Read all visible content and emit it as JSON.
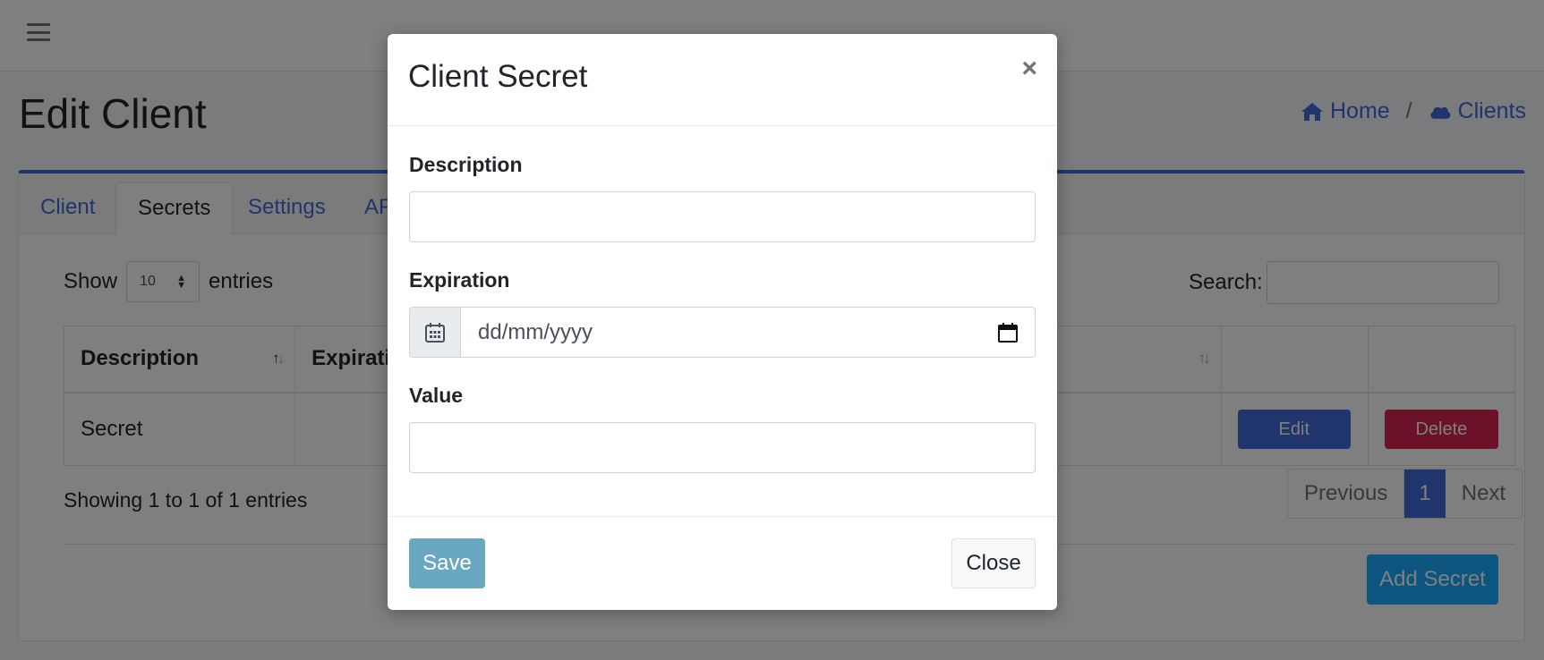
{
  "navbar": {
    "menu_icon": "hamburger-icon"
  },
  "page": {
    "title": "Edit Client",
    "breadcrumb": [
      {
        "label": "Home",
        "icon": "home-icon"
      },
      {
        "label": "Clients",
        "icon": "cloud-icon"
      }
    ],
    "breadcrumb_separator": "/"
  },
  "tabs": [
    {
      "label": "Client",
      "active": false
    },
    {
      "label": "Secrets",
      "active": true
    },
    {
      "label": "Settings",
      "active": false
    },
    {
      "label": "AP",
      "active": false
    }
  ],
  "table_controls": {
    "show_label": "Show",
    "entries_value": "10",
    "entries_label": "entries",
    "search_label": "Search:"
  },
  "table": {
    "headers": [
      "Description",
      "Expiration",
      ""
    ],
    "rows": [
      {
        "description": "Secret",
        "expiration": "",
        "value": "",
        "edit_label": "Edit",
        "delete_label": "Delete"
      }
    ]
  },
  "footer": {
    "showing": "Showing 1 to 1 of 1 entries",
    "pagination": {
      "previous": "Previous",
      "current": "1",
      "next": "Next"
    },
    "add_button": "Add Secret"
  },
  "modal": {
    "title": "Client Secret",
    "close_symbol": "×",
    "fields": {
      "description_label": "Description",
      "description_value": "",
      "expiration_label": "Expiration",
      "expiration_placeholder": "dd/mm/yyyy",
      "value_label": "Value",
      "value_value": ""
    },
    "save_label": "Save",
    "close_label": "Close"
  },
  "colors": {
    "primary": "#3f6ad8",
    "danger": "#d92550",
    "info": "#16aaff",
    "save": "#6aa7c0"
  }
}
